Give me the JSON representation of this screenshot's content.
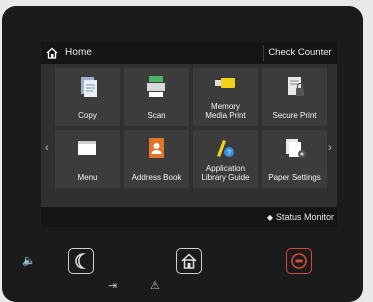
{
  "screen": {
    "title": "Home",
    "check_counter": "Check Counter",
    "status_monitor": "Status Monitor",
    "page_dots": "● • • •",
    "tiles": [
      {
        "label_line1": "Copy",
        "label_line2": ""
      },
      {
        "label_line1": "Scan",
        "label_line2": ""
      },
      {
        "label_line1": "Memory",
        "label_line2": "Media Print"
      },
      {
        "label_line1": "Secure Print",
        "label_line2": ""
      },
      {
        "label_line1": "Menu",
        "label_line2": ""
      },
      {
        "label_line1": "Address Book",
        "label_line2": ""
      },
      {
        "label_line1": "Application",
        "label_line2": "Library Guide"
      },
      {
        "label_line1": "Paper Settings",
        "label_line2": ""
      }
    ]
  },
  "hardware": {
    "sleep_icon": "moon-icon",
    "home_icon": "home-icon",
    "stop_icon": "stop-icon",
    "volume_icon": "speaker-icon",
    "data_icon": "data-arrow-icon",
    "alert_icon": "warning-icon"
  },
  "colors": {
    "device": "#1b1b1b",
    "screen_bg": "#303030",
    "tile": "#3c3c3c",
    "stop_red": "#d54a3c"
  }
}
